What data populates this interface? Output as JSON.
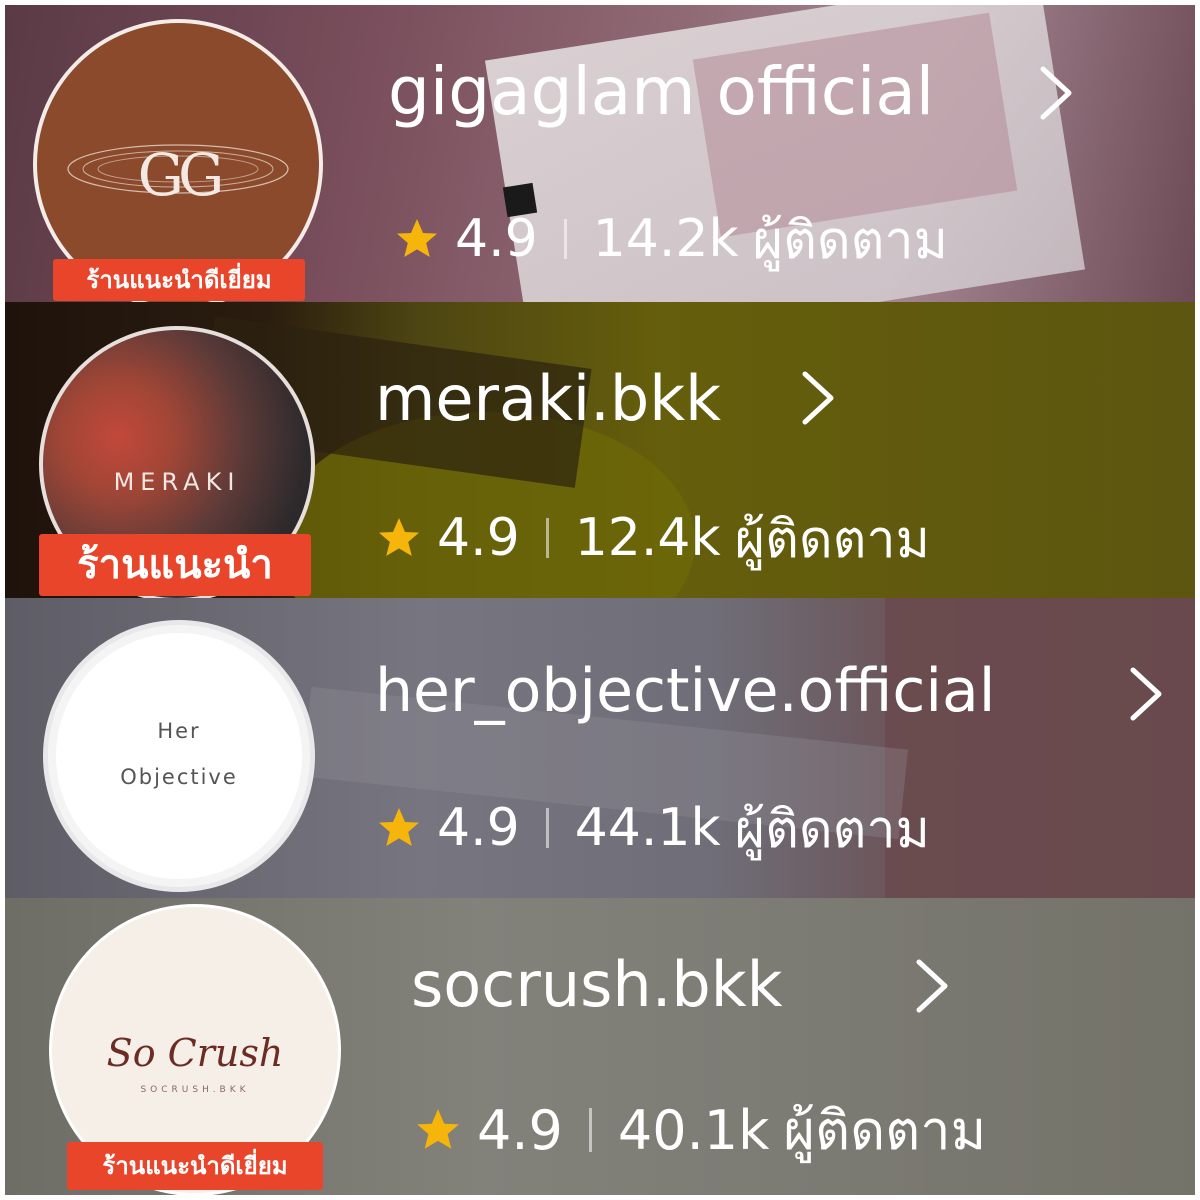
{
  "stores": [
    {
      "name": "gigaglam official",
      "logo_text": "GG",
      "badge": "ร้านแนะนำดีเยี่ยม",
      "rating": "4.9",
      "followers": "14.2k",
      "followers_label": "ผู้ติดตาม"
    },
    {
      "name": "meraki.bkk",
      "logo_text": "MERAKI",
      "badge": "ร้านแนะนำ",
      "rating": "4.9",
      "followers": "12.4k",
      "followers_label": "ผู้ติดตาม"
    },
    {
      "name": "her_objective.official",
      "logo_text_1": "Her",
      "logo_text_2": "Objective",
      "rating": "4.9",
      "followers": "44.1k",
      "followers_label": "ผู้ติดตาม"
    },
    {
      "name": "socrush.bkk",
      "logo_text": "So Crush",
      "logo_subtext": "SOCRUSH.BKK",
      "badge": "ร้านแนะนำดีเยี่ยม",
      "rating": "4.9",
      "followers": "40.1k",
      "followers_label": "ผู้ติดตาม"
    }
  ],
  "colors": {
    "badge": "#e8452a",
    "star": "#f5b50a",
    "row1_bg": "#7a4e5c",
    "row2_bg": "#5c5610",
    "row3_bg": "#6c6a74",
    "row4_bg": "#7c7b73",
    "gg_logo": "#8a4a2b"
  },
  "icons": [
    "star-icon",
    "chevron-right-icon"
  ]
}
